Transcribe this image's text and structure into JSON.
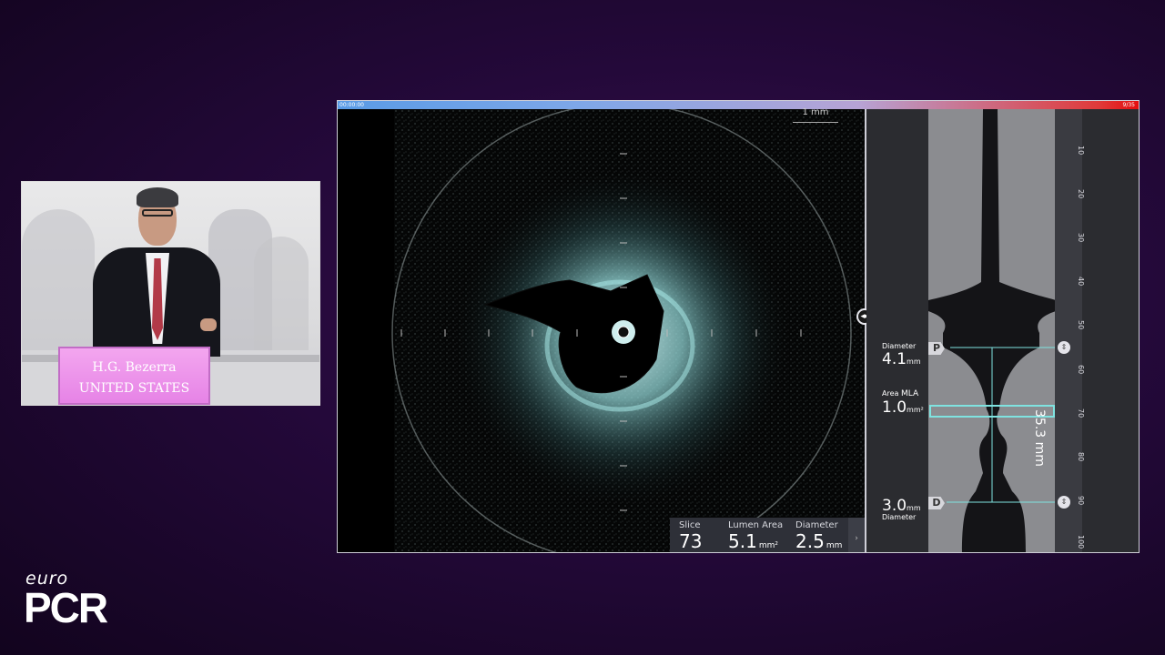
{
  "speaker": {
    "name_line": "H.G. Bezerra",
    "country_line": "UNITED STATES"
  },
  "logo": {
    "euro": "euro",
    "pcr": "PCR"
  },
  "oct": {
    "time_start": "00:00:00",
    "frame_counter": "9/35",
    "scale_label": "1 mm",
    "info": {
      "slice_label": "Slice",
      "slice_value": "73",
      "lumen_area_label": "Lumen Area",
      "lumen_area_value": "5.1",
      "lumen_area_unit": "mm²",
      "diameter_label": "Diameter",
      "diameter_value": "2.5",
      "diameter_unit": "mm"
    },
    "longitudinal": {
      "proximal": {
        "label": "Diameter",
        "value": "4.1",
        "unit": "mm",
        "marker": "P"
      },
      "mla": {
        "area_label": "Area",
        "tag": "MLA",
        "value": "1.0",
        "unit": "mm²"
      },
      "distal": {
        "label": "Diameter",
        "value": "3.0",
        "unit": "mm",
        "marker": "D"
      },
      "length_value": "35.3 mm",
      "ruler_ticks": [
        "10",
        "20",
        "30",
        "40",
        "50",
        "60",
        "70",
        "80",
        "90",
        "100"
      ]
    }
  },
  "colors": {
    "background": "#24093a",
    "podium": "#e683e6",
    "lumen_outline": "#7fe3e0"
  }
}
